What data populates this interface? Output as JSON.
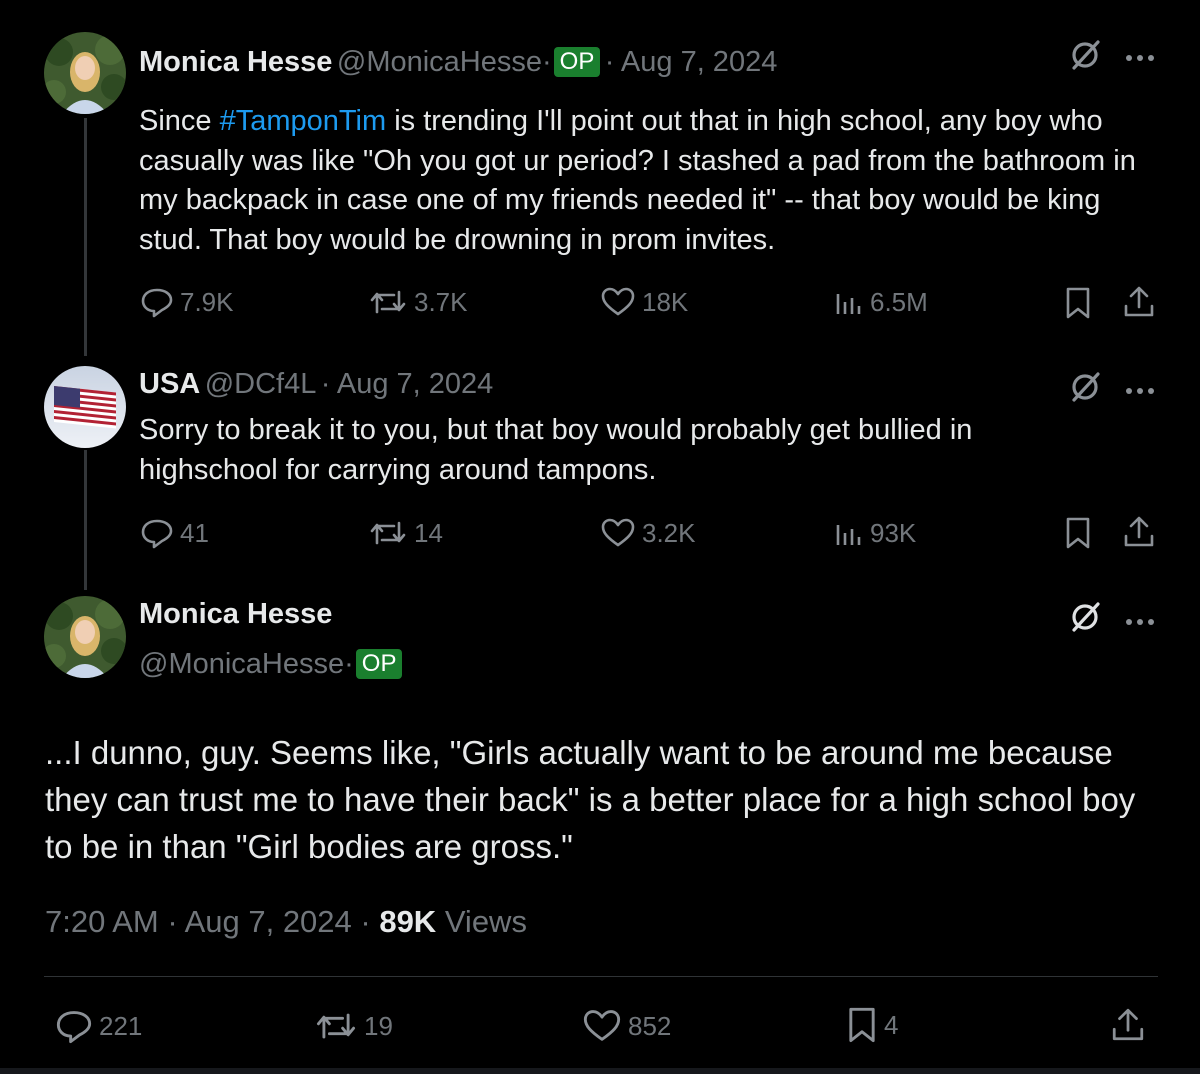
{
  "tweets": [
    {
      "name": "Monica Hesse",
      "handle": "@MonicaHesse·",
      "op": "OP",
      "date": "· Aug 7, 2024",
      "text_before": "Since ",
      "hashtag": "#TamponTim",
      "text_after": " is trending I'll point out that in high school, any boy who casually was like \"Oh you got ur period? I stashed a pad from the bathroom in my backpack in case one of my friends needed it\" -- that boy would be king stud. That boy would be drowning in prom invites.",
      "replies": "7.9K",
      "reposts": "3.7K",
      "likes": "18K",
      "views": "6.5M"
    },
    {
      "name": "USA",
      "handle": "@DCf4L",
      "date": "· Aug 7, 2024",
      "text": "Sorry to break it to you, but that boy would probably get bullied in highschool for carrying around tampons.",
      "replies": "41",
      "reposts": "14",
      "likes": "3.2K",
      "views": "93K"
    }
  ],
  "main": {
    "name": "Monica Hesse",
    "handle": "@MonicaHesse·",
    "op": "OP",
    "text": "...I dunno, guy. Seems like, \"Girls actually want to be around me because they can trust me to have their back\" is a better place for a high school boy to be in than \"Girl bodies are gross.\"",
    "time": "7:20 AM · Aug 7, 2024 · ",
    "view_count": "89K",
    "views_label": " Views",
    "replies": "221",
    "reposts": "19",
    "likes": "852",
    "bookmarks": "4"
  },
  "icons": {
    "grok": "grok-slash-icon",
    "more": "more-dots-icon"
  },
  "colors": {
    "background": "#000000",
    "text": "#e7e9ea",
    "muted": "#71767b",
    "link": "#1d9bf0",
    "op_badge": "#1a7f2e"
  }
}
